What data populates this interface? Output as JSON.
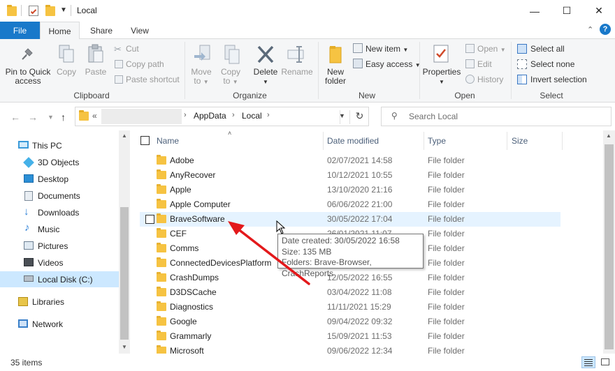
{
  "window": {
    "title": "Local",
    "controls": {
      "minimize": "—",
      "maximize": "☐",
      "close": "✕"
    }
  },
  "ribbon": {
    "tabs": {
      "file": "File",
      "home": "Home",
      "share": "Share",
      "view": "View"
    },
    "clipboard": {
      "label": "Clipboard",
      "pin_to_quick_access": "Pin to Quick access",
      "copy": "Copy",
      "paste": "Paste",
      "cut": "Cut",
      "copy_path": "Copy path",
      "paste_shortcut": "Paste shortcut"
    },
    "organize": {
      "label": "Organize",
      "move_to": "Move",
      "move_to_2": "to",
      "copy_to": "Copy",
      "copy_to_2": "to",
      "delete": "Delete",
      "rename": "Rename"
    },
    "new": {
      "label": "New",
      "new_folder": "New folder",
      "new_item": "New item",
      "easy_access": "Easy access"
    },
    "open": {
      "label": "Open",
      "properties": "Properties",
      "open": "Open",
      "edit": "Edit",
      "history": "History"
    },
    "select": {
      "label": "Select",
      "select_all": "Select all",
      "select_none": "Select none",
      "invert_selection": "Invert selection"
    }
  },
  "address": {
    "prefix": "«",
    "crumbs": [
      "AppData",
      "Local"
    ],
    "search_placeholder": "Search Local"
  },
  "nav_pane": {
    "items": [
      {
        "label": "This PC",
        "icon": "monitor-icon"
      },
      {
        "label": "3D Objects",
        "icon": "cube-icon"
      },
      {
        "label": "Desktop",
        "icon": "desktop-icon"
      },
      {
        "label": "Documents",
        "icon": "documents-icon"
      },
      {
        "label": "Downloads",
        "icon": "download-icon"
      },
      {
        "label": "Music",
        "icon": "music-icon"
      },
      {
        "label": "Pictures",
        "icon": "pictures-icon"
      },
      {
        "label": "Videos",
        "icon": "videos-icon"
      },
      {
        "label": "Local Disk (C:)",
        "icon": "drive-icon"
      },
      {
        "label": "Libraries",
        "icon": "libraries-icon"
      },
      {
        "label": "Network",
        "icon": "network-icon"
      }
    ]
  },
  "columns": {
    "name": "Name",
    "date_modified": "Date modified",
    "type": "Type",
    "size": "Size"
  },
  "files": [
    {
      "name": "Adobe",
      "date": "02/07/2021 14:58",
      "type": "File folder"
    },
    {
      "name": "AnyRecover",
      "date": "10/12/2021 10:55",
      "type": "File folder"
    },
    {
      "name": "Apple",
      "date": "13/10/2020 21:16",
      "type": "File folder"
    },
    {
      "name": "Apple Computer",
      "date": "06/06/2022 21:00",
      "type": "File folder"
    },
    {
      "name": "BraveSoftware",
      "date": "30/05/2022 17:04",
      "type": "File folder"
    },
    {
      "name": "CEF",
      "date": "26/01/2021 11:07",
      "type": "File folder"
    },
    {
      "name": "Comms",
      "date": "",
      "type": "File folder"
    },
    {
      "name": "ConnectedDevicesPlatform",
      "date": "",
      "type": "File folder"
    },
    {
      "name": "CrashDumps",
      "date": "12/05/2022 16:55",
      "type": "File folder"
    },
    {
      "name": "D3DSCache",
      "date": "03/04/2022 11:08",
      "type": "File folder"
    },
    {
      "name": "Diagnostics",
      "date": "11/11/2021 15:29",
      "type": "File folder"
    },
    {
      "name": "Google",
      "date": "09/04/2022 09:32",
      "type": "File folder"
    },
    {
      "name": "Grammarly",
      "date": "15/09/2021 11:53",
      "type": "File folder"
    },
    {
      "name": "Microsoft",
      "date": "09/06/2022 12:34",
      "type": "File folder"
    }
  ],
  "tooltip": {
    "line1": "Date created: 30/05/2022 16:58",
    "line2": "Size: 135 MB",
    "line3": "Folders: Brave-Browser, CrashReports"
  },
  "status": {
    "item_count": "35 items"
  },
  "colors": {
    "accent": "#1979ca",
    "folder": "#f6c342",
    "selection": "#cce8ff",
    "hover": "#e5f3ff",
    "annotation_arrow": "#e3191b"
  }
}
